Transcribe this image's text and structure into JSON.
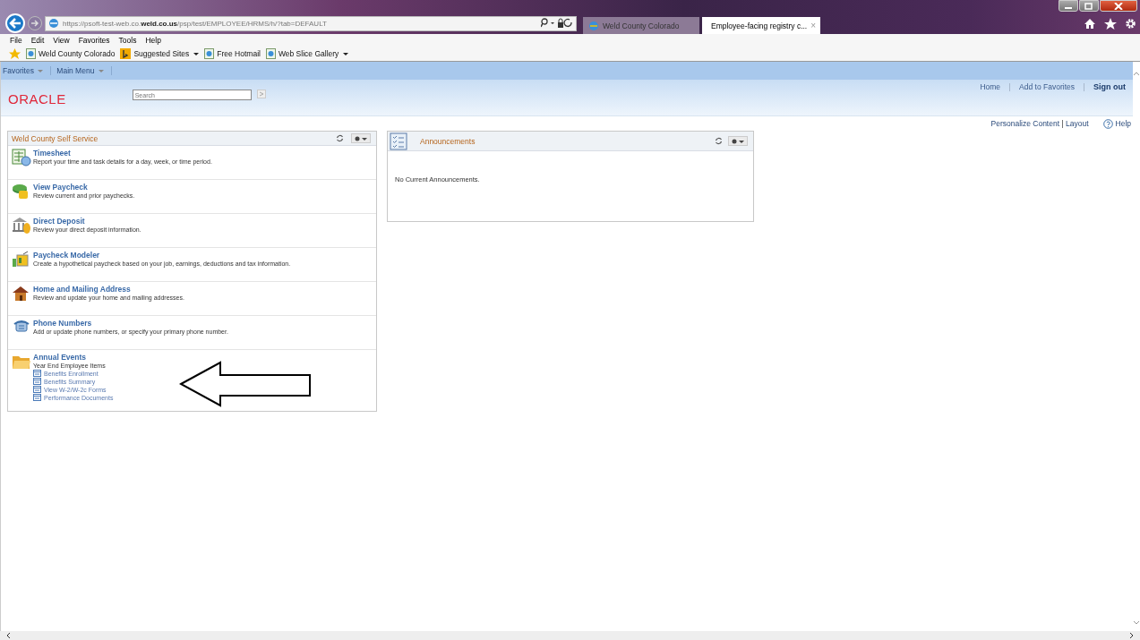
{
  "browser": {
    "address": "https://psoft-test-web.co.**weld.co.us**/psp/test/EMPLOYEE/HRMS/h/?tab=DEFAULT",
    "tabs": [
      {
        "label": "Weld County Colorado",
        "selected": false
      },
      {
        "label": "Employee-facing registry c...",
        "selected": true,
        "close": "×"
      }
    ],
    "menu": [
      "File",
      "Edit",
      "View",
      "Favorites",
      "Tools",
      "Help"
    ],
    "favorites_bar": [
      {
        "label": "Weld County Colorado",
        "kind": "page",
        "dropdown": false
      },
      {
        "label": "Suggested Sites",
        "kind": "bing",
        "dropdown": true
      },
      {
        "label": "Free Hotmail",
        "kind": "page",
        "dropdown": false
      },
      {
        "label": "Web Slice Gallery",
        "kind": "page",
        "dropdown": true
      }
    ]
  },
  "nav": [
    {
      "label": "Favorites"
    },
    {
      "label": "Main Menu"
    }
  ],
  "header": {
    "logo": "ORACLE",
    "search": {
      "placeholder": "Search"
    },
    "links": [
      {
        "label": "Home",
        "bold": false
      },
      {
        "label": "Add to Favorites",
        "bold": false
      },
      {
        "label": "Sign out",
        "bold": true
      }
    ]
  },
  "personalize": {
    "content": "Personalize Content",
    "separator": "|",
    "layout": "Layout",
    "help": "Help"
  },
  "self_service": {
    "title": "Weld County Self Service",
    "items": [
      {
        "kind": "timesheet",
        "title": "Timesheet",
        "description": "Report your time and task details for a day, week, or time period."
      },
      {
        "kind": "paycheck",
        "title": "View Paycheck",
        "description": "Review current and prior paychecks."
      },
      {
        "kind": "bank",
        "title": "Direct Deposit",
        "description": "Review your direct deposit information."
      },
      {
        "kind": "modeler",
        "title": "Paycheck Modeler",
        "description": "Create a hypothetical paycheck based on your job, earnings, deductions and tax information."
      },
      {
        "kind": "house",
        "title": "Home and Mailing Address",
        "description": "Review and update your home and mailing addresses."
      },
      {
        "kind": "phone",
        "title": "Phone Numbers",
        "description": "Add or update phone numbers, or specify your primary phone number."
      },
      {
        "kind": "folder",
        "title": "Annual Events",
        "description": "Year End Employee Items",
        "links": [
          "Benefits Enrollment",
          "Benefits Summary",
          "View W-2/W-2c Forms",
          "Performance Documents"
        ]
      }
    ]
  },
  "announcements": {
    "title": "Announcements",
    "message": "No Current Announcements."
  }
}
